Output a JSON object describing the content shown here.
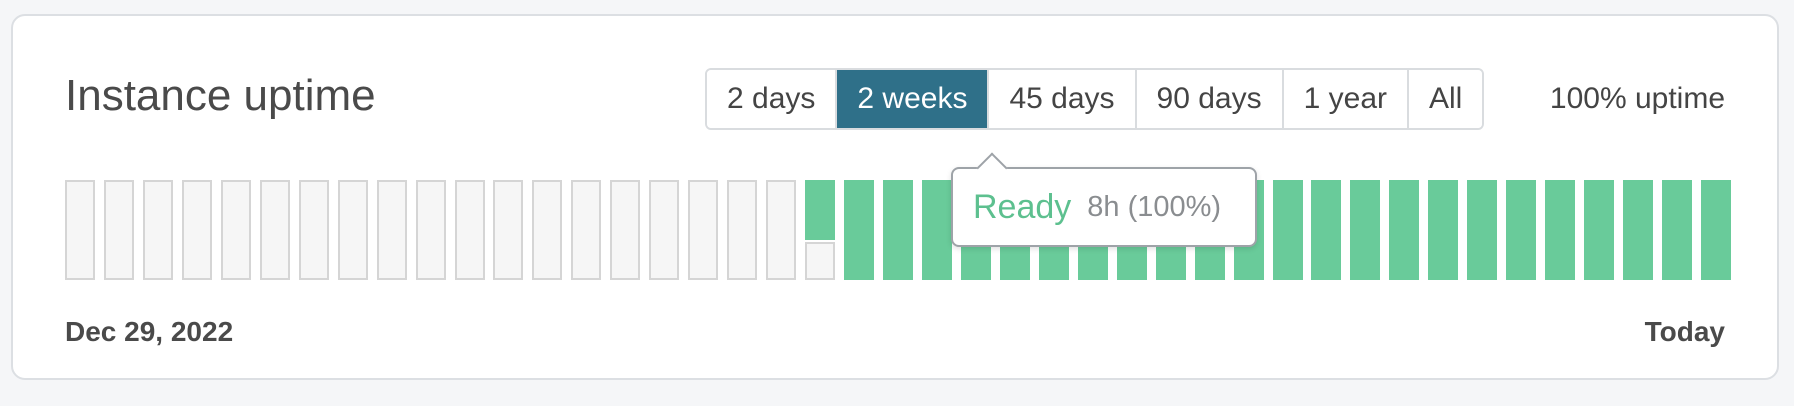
{
  "card": {
    "title": "Instance uptime",
    "uptime_text": "100% uptime",
    "ranges": [
      {
        "label": "2 days",
        "active": false
      },
      {
        "label": "2 weeks",
        "active": true
      },
      {
        "label": "45 days",
        "active": false
      },
      {
        "label": "90 days",
        "active": false
      },
      {
        "label": "1 year",
        "active": false
      },
      {
        "label": "All",
        "active": false
      }
    ],
    "start_label": "Dec 29, 2022",
    "end_label": "Today"
  },
  "tooltip": {
    "status": "Ready",
    "detail": "8h (100%)"
  },
  "colors": {
    "up": "#69cb9a",
    "empty": "#f6f6f6",
    "accent": "#2f7089"
  },
  "bars": [
    "empty",
    "empty",
    "empty",
    "empty",
    "empty",
    "empty",
    "empty",
    "empty",
    "empty",
    "empty",
    "empty",
    "empty",
    "empty",
    "empty",
    "empty",
    "empty",
    "empty",
    "empty",
    "empty",
    "partial",
    "up",
    "up",
    "up",
    "up",
    "up",
    "up",
    "up",
    "up",
    "up",
    "up",
    "up",
    "up",
    "up",
    "up",
    "up",
    "up",
    "up",
    "up",
    "up",
    "up",
    "up",
    "up",
    "up"
  ]
}
